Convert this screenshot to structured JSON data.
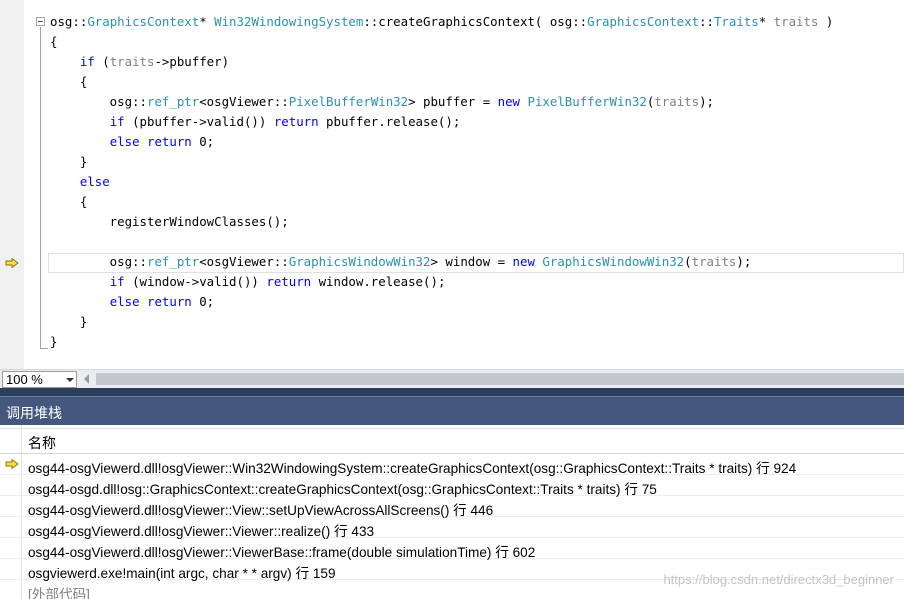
{
  "editor": {
    "code_lines": [
      [
        {
          "t": "osg::",
          "c": ""
        },
        {
          "t": "GraphicsContext",
          "c": "ty"
        },
        {
          "t": "* ",
          "c": ""
        },
        {
          "t": "Win32WindowingSystem",
          "c": "ty"
        },
        {
          "t": "::createGraphicsContext( osg::",
          "c": ""
        },
        {
          "t": "GraphicsContext",
          "c": "ty"
        },
        {
          "t": "::",
          "c": ""
        },
        {
          "t": "Traits",
          "c": "ty"
        },
        {
          "t": "* ",
          "c": ""
        },
        {
          "t": "traits",
          "c": "pa"
        },
        {
          "t": " )",
          "c": ""
        }
      ],
      [
        {
          "t": "{",
          "c": ""
        }
      ],
      [
        {
          "t": "    ",
          "c": ""
        },
        {
          "t": "if",
          "c": "kw"
        },
        {
          "t": " (",
          "c": ""
        },
        {
          "t": "traits",
          "c": "pa"
        },
        {
          "t": "->pbuffer)",
          "c": ""
        }
      ],
      [
        {
          "t": "    {",
          "c": ""
        }
      ],
      [
        {
          "t": "        osg::",
          "c": ""
        },
        {
          "t": "ref_ptr",
          "c": "ty"
        },
        {
          "t": "<osgViewer::",
          "c": ""
        },
        {
          "t": "PixelBufferWin32",
          "c": "ty"
        },
        {
          "t": "> pbuffer = ",
          "c": ""
        },
        {
          "t": "new",
          "c": "kw"
        },
        {
          "t": " ",
          "c": ""
        },
        {
          "t": "PixelBufferWin32",
          "c": "ty"
        },
        {
          "t": "(",
          "c": ""
        },
        {
          "t": "traits",
          "c": "pa"
        },
        {
          "t": ");",
          "c": ""
        }
      ],
      [
        {
          "t": "        ",
          "c": ""
        },
        {
          "t": "if",
          "c": "kw"
        },
        {
          "t": " (pbuffer->valid()) ",
          "c": ""
        },
        {
          "t": "return",
          "c": "kw"
        },
        {
          "t": " pbuffer.release();",
          "c": ""
        }
      ],
      [
        {
          "t": "        ",
          "c": ""
        },
        {
          "t": "else",
          "c": "kw"
        },
        {
          "t": " ",
          "c": ""
        },
        {
          "t": "return",
          "c": "kw"
        },
        {
          "t": " 0;",
          "c": ""
        }
      ],
      [
        {
          "t": "    }",
          "c": ""
        }
      ],
      [
        {
          "t": "    ",
          "c": ""
        },
        {
          "t": "else",
          "c": "kw"
        }
      ],
      [
        {
          "t": "    {",
          "c": ""
        }
      ],
      [
        {
          "t": "        registerWindowClasses();",
          "c": ""
        }
      ],
      [
        {
          "t": "",
          "c": ""
        }
      ],
      [
        {
          "t": "        osg::",
          "c": ""
        },
        {
          "t": "ref_ptr",
          "c": "ty"
        },
        {
          "t": "<osgViewer::",
          "c": ""
        },
        {
          "t": "GraphicsWindowWin32",
          "c": "ty"
        },
        {
          "t": "> window = ",
          "c": ""
        },
        {
          "t": "new",
          "c": "kw"
        },
        {
          "t": " ",
          "c": ""
        },
        {
          "t": "GraphicsWindowWin32",
          "c": "ty"
        },
        {
          "t": "(",
          "c": ""
        },
        {
          "t": "traits",
          "c": "pa"
        },
        {
          "t": ");",
          "c": ""
        }
      ],
      [
        {
          "t": "        ",
          "c": ""
        },
        {
          "t": "if",
          "c": "kw"
        },
        {
          "t": " (window->valid()) ",
          "c": ""
        },
        {
          "t": "return",
          "c": "kw"
        },
        {
          "t": " window.release();",
          "c": ""
        }
      ],
      [
        {
          "t": "        ",
          "c": ""
        },
        {
          "t": "else",
          "c": "kw"
        },
        {
          "t": " ",
          "c": ""
        },
        {
          "t": "return",
          "c": "kw"
        },
        {
          "t": " 0;",
          "c": ""
        }
      ],
      [
        {
          "t": "    }",
          "c": ""
        }
      ],
      [
        {
          "t": "}",
          "c": ""
        }
      ]
    ],
    "current_line_index": 12,
    "syntax_colors": {
      "keyword": "#0000ff",
      "type": "#2b91af",
      "parameter": "#808080"
    },
    "marker_icon": "execution-pointer-arrow-icon",
    "marker_color": "#ffd94a"
  },
  "zoom": {
    "value": "100 %"
  },
  "call_stack": {
    "title": "调用堆栈",
    "column_name": "名称",
    "frames": [
      {
        "text": "osg44-osgViewerd.dll!osgViewer::Win32WindowingSystem::createGraphicsContext(osg::GraphicsContext::Traits * traits) 行 924",
        "current": true
      },
      {
        "text": "osg44-osgd.dll!osg::GraphicsContext::createGraphicsContext(osg::GraphicsContext::Traits * traits) 行 75",
        "current": false
      },
      {
        "text": "osg44-osgViewerd.dll!osgViewer::View::setUpViewAcrossAllScreens() 行 446",
        "current": false
      },
      {
        "text": "osg44-osgViewerd.dll!osgViewer::Viewer::realize() 行 433",
        "current": false
      },
      {
        "text": "osg44-osgViewerd.dll!osgViewer::ViewerBase::frame(double simulationTime) 行 602",
        "current": false
      },
      {
        "text": "osgviewerd.exe!main(int argc, char * * argv) 行 159",
        "current": false
      },
      {
        "text": "[外部代码]",
        "current": false,
        "dim": true
      }
    ]
  },
  "watermark": "https://blog.csdn.net/directx3d_beginner",
  "colors": {
    "panel_title_bg": "#44587d",
    "panel_separator": "#2d3e5c"
  }
}
